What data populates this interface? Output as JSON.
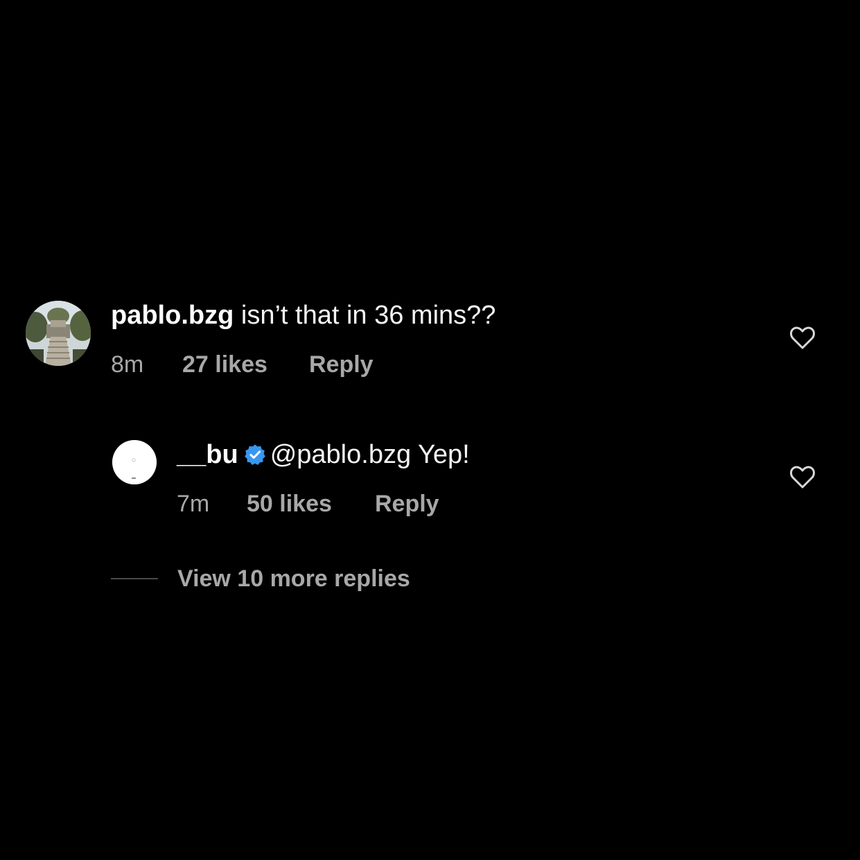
{
  "comment": {
    "username": "pablo.bzg",
    "text": "isn’t that in 36 mins??",
    "time": "8m",
    "likes": "27 likes",
    "reply_label": "Reply",
    "like_icon": "heart-outline-icon"
  },
  "reply": {
    "username": "__bu",
    "verified_icon": "verified-badge-icon",
    "mention": "@pablo.bzg",
    "text": "Yep!",
    "time": "7m",
    "likes": "50 likes",
    "reply_label": "Reply",
    "like_icon": "heart-outline-icon"
  },
  "view_more_replies": "View 10 more replies",
  "colors": {
    "background": "#000000",
    "primary_text": "#f5f5f5",
    "secondary_text": "#a8a8a8",
    "verified_blue": "#3897f0"
  }
}
